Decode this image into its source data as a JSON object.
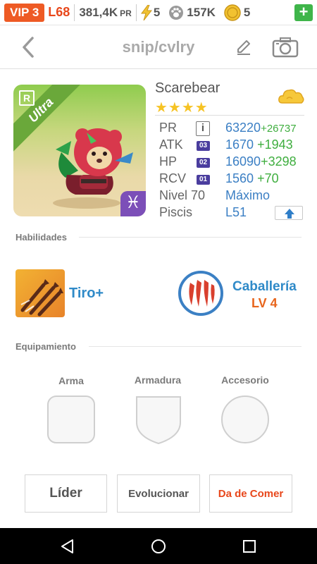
{
  "status_bar": {
    "vip": "VIP 3",
    "level": "L68",
    "power": "381,4K",
    "power_unit": "PR",
    "energy": "5",
    "paws": "157K",
    "coins": "5",
    "add_symbol": "+"
  },
  "header": {
    "title": "snip/cvlry"
  },
  "hero": {
    "rarity_badge": "R",
    "rarity": "Ultra",
    "zodiac_symbol": "♓",
    "name": "Scarebear",
    "stars": "★★★★",
    "star_count": 4,
    "info_symbol": "i",
    "stats": [
      {
        "label": "PR",
        "value": "63220",
        "bonus": "+26737"
      },
      {
        "label": "ATK",
        "tag": "03",
        "value": "1670",
        "bonus": "+1943"
      },
      {
        "label": "HP",
        "tag": "02",
        "value": "16090",
        "bonus": "+3298"
      },
      {
        "label": "RCV",
        "tag": "01",
        "value": "1560",
        "bonus": "+70"
      }
    ],
    "level_label": "Nivel 70",
    "level_value": "Máximo",
    "zodiac_label": "Piscis",
    "zodiac_value": "L51"
  },
  "skills": {
    "title": "Habilidades",
    "skill_name": "Tiro+",
    "ability_name": "Caballería",
    "ability_level": "LV 4"
  },
  "equipment": {
    "title": "Equipamiento",
    "slots": [
      "Arma",
      "Armadura",
      "Accesorio"
    ]
  },
  "actions": {
    "leader": "Líder",
    "evolve": "Evolucionar",
    "feed": "Da de Comer"
  },
  "colors": {
    "accent_blue": "#3b7fc4",
    "bonus_green": "#3fae3f",
    "orange": "#e8651c",
    "vip_orange": "#ee5a24"
  }
}
